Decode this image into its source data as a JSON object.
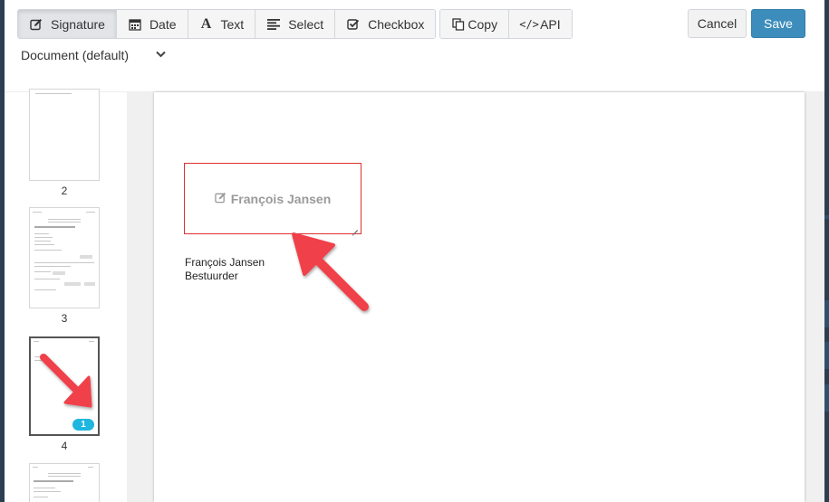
{
  "toolbar": {
    "signature": "Signature",
    "date": "Date",
    "text": "Text",
    "select": "Select",
    "checkbox": "Checkbox",
    "copy": "Copy",
    "api": "API",
    "cancel": "Cancel",
    "save": "Save"
  },
  "document_select": {
    "value": "Document (default)"
  },
  "thumbnails": [
    {
      "number": "2"
    },
    {
      "number": "3"
    },
    {
      "number": "4",
      "badge": "1",
      "selected": true
    }
  ],
  "signature_field": {
    "label": "François Jansen",
    "icon": "edit-icon"
  },
  "signer": {
    "name": "François Jansen",
    "role": "Bestuurder"
  },
  "colors": {
    "accent": "#3c8dbc",
    "field_border": "#e03030",
    "badge": "#1fb6e0",
    "arrow": "#f0414a"
  }
}
